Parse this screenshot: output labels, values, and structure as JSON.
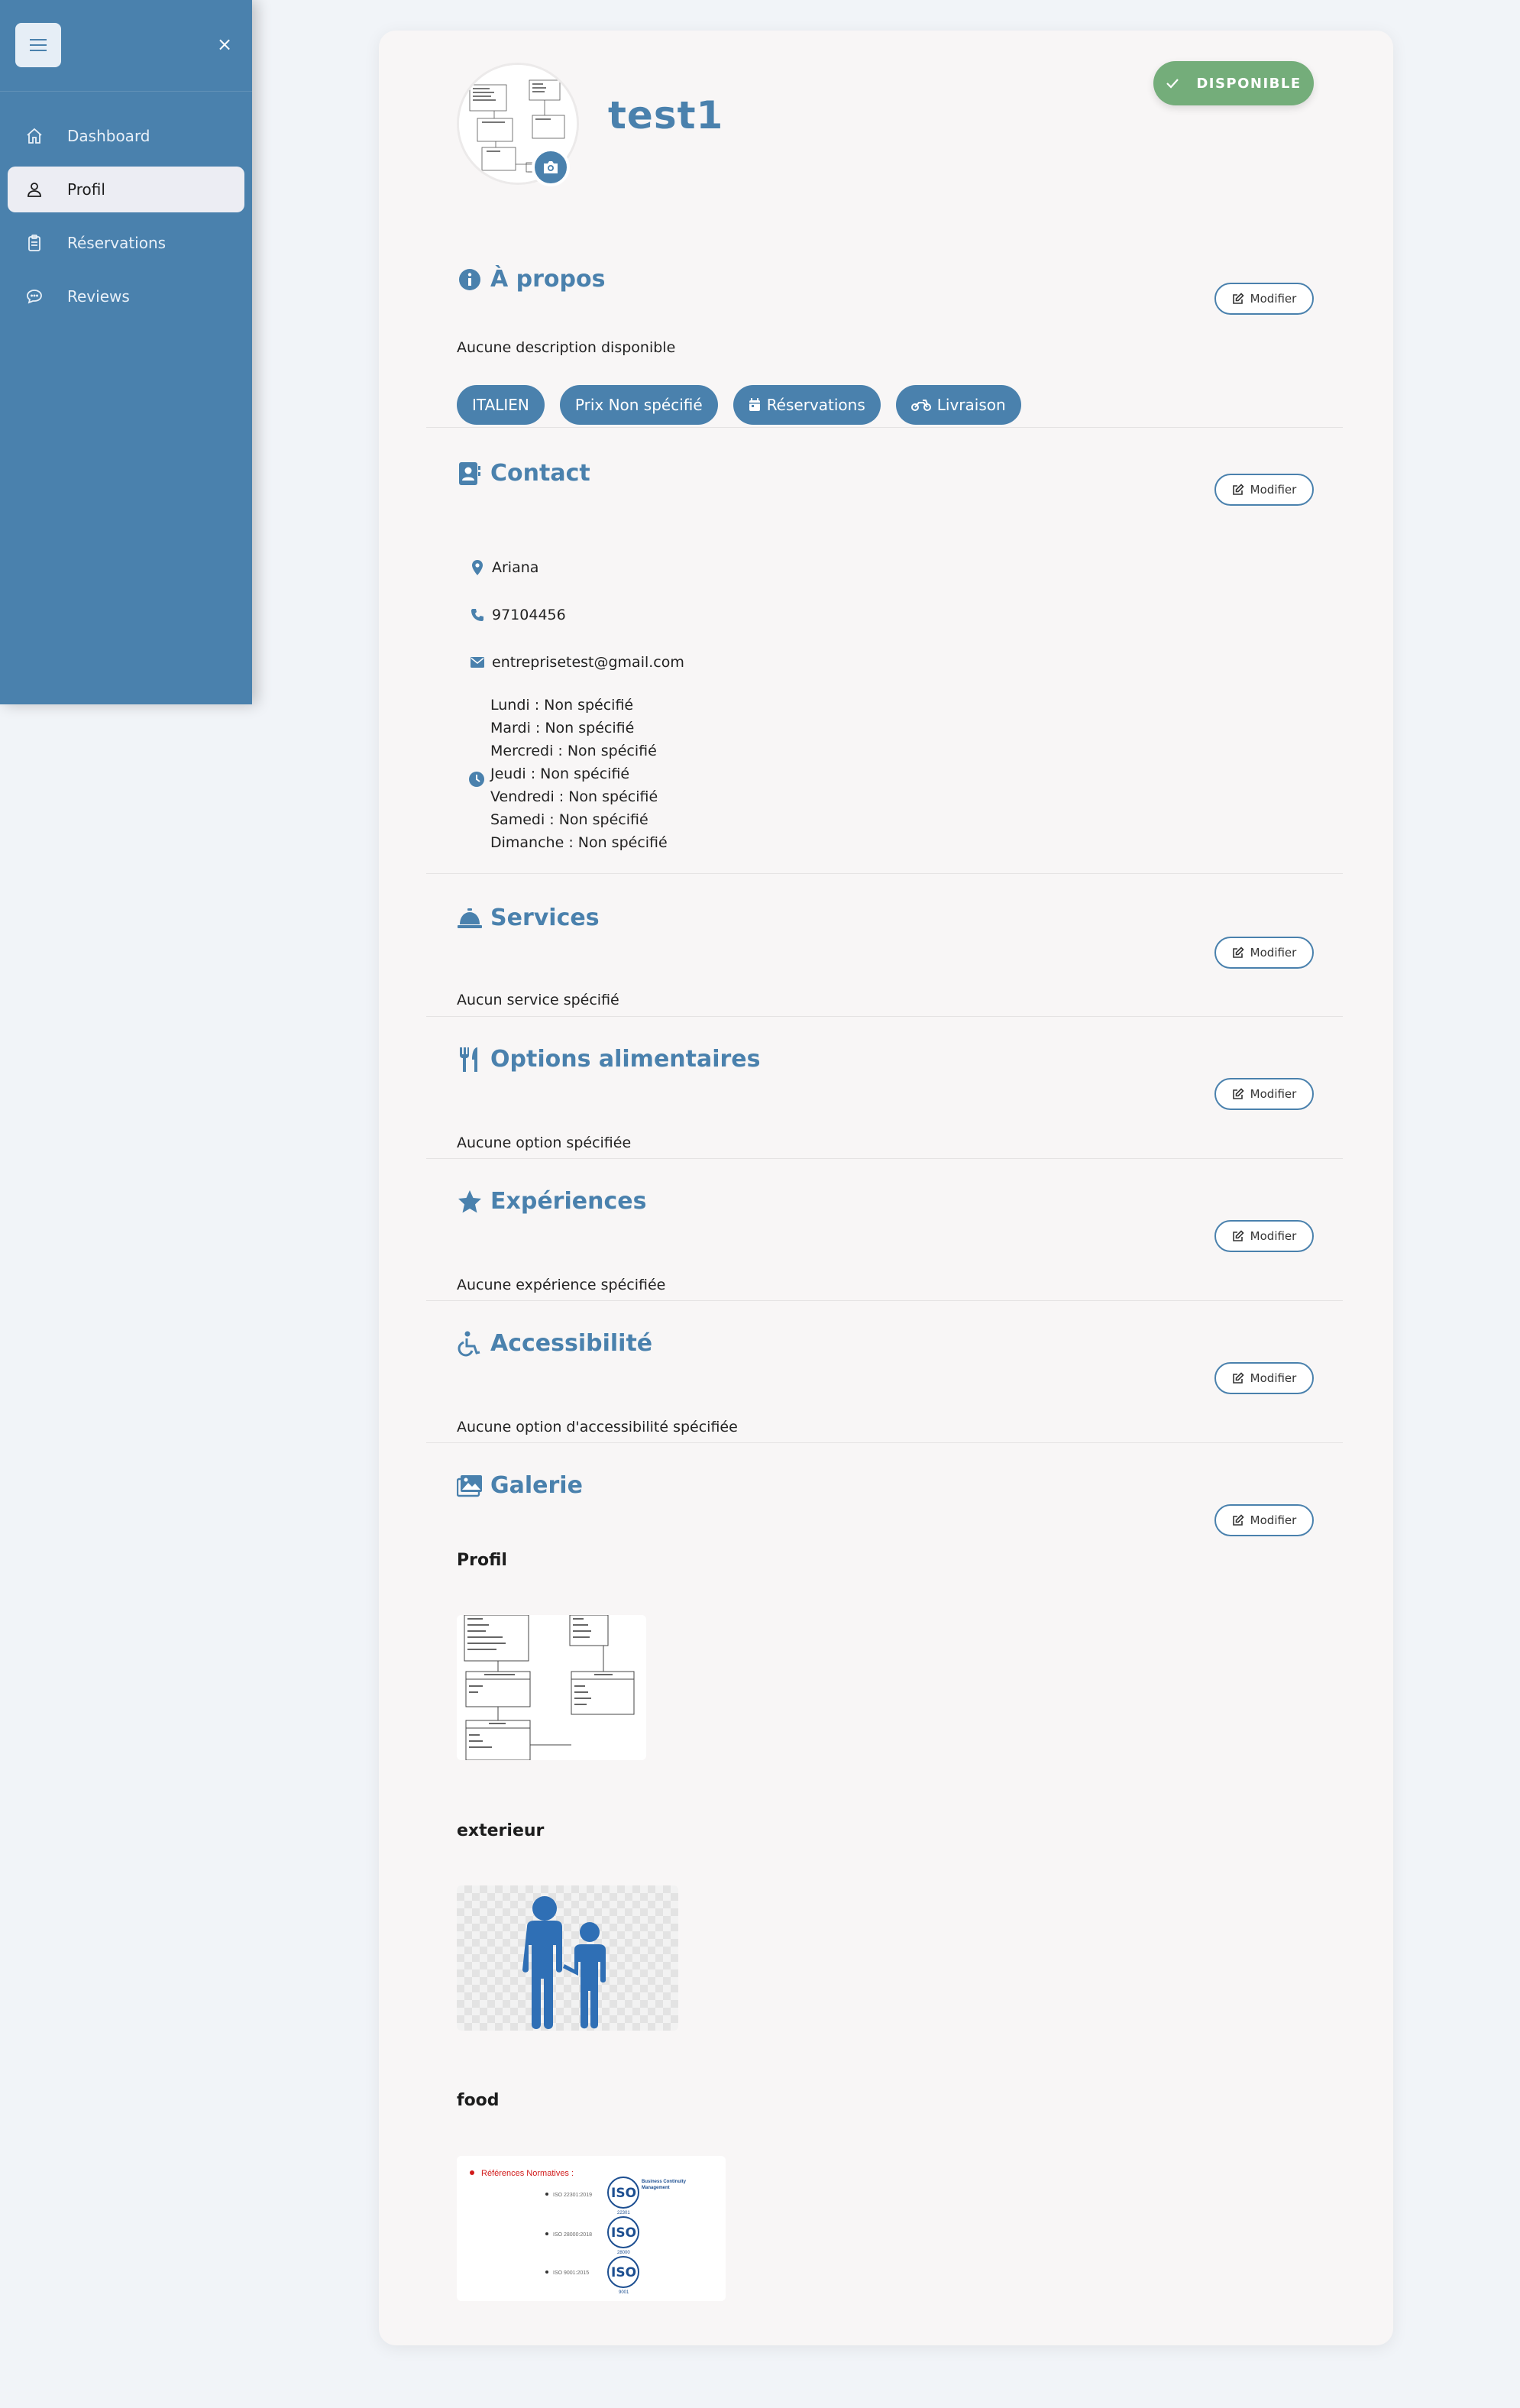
{
  "sidebar": {
    "items": [
      {
        "label": "Dashboard",
        "icon": "home-icon"
      },
      {
        "label": "Profil",
        "icon": "user-icon"
      },
      {
        "label": "Réservations",
        "icon": "clipboard-icon"
      },
      {
        "label": "Reviews",
        "icon": "chat-icon"
      }
    ],
    "close_label": "×",
    "active": "Profil"
  },
  "profile": {
    "name": "test1",
    "status": "DISPONIBLE",
    "status_color": "#74ad7a"
  },
  "about": {
    "title": "À propos",
    "modify_label": "Modifier",
    "description": "Aucune description disponible",
    "tags": [
      "ITALIEN",
      "Prix Non spécifié",
      "Réservations",
      "Livraison"
    ]
  },
  "contact": {
    "title": "Contact",
    "modify_label": "Modifier",
    "location": "Ariana",
    "phone": "97104456",
    "email": "entreprisetest@gmail.com",
    "hours": [
      "Lundi : Non spécifié",
      "Mardi : Non spécifié",
      "Mercredi : Non spécifié",
      "Jeudi : Non spécifié",
      "Vendredi : Non spécifié",
      "Samedi : Non spécifié",
      "Dimanche : Non spécifié"
    ]
  },
  "services": {
    "title": "Services",
    "modify_label": "Modifier",
    "text": "Aucun service spécifié"
  },
  "dietary": {
    "title": "Options alimentaires",
    "modify_label": "Modifier",
    "text": "Aucune option spécifiée"
  },
  "experiences": {
    "title": "Expériences",
    "modify_label": "Modifier",
    "text": "Aucune expérience spécifiée"
  },
  "accessibility": {
    "title": "Accessibilité",
    "modify_label": "Modifier",
    "text": "Aucune option d'accessibilité spécifiée"
  },
  "gallery": {
    "title": "Galerie",
    "modify_label": "Modifier",
    "groups": [
      {
        "label": "Profil"
      },
      {
        "label": "exterieur"
      },
      {
        "label": "food"
      }
    ],
    "food_image": {
      "heading": "Références Normatives :",
      "items": [
        "ISO 22301:2019",
        "ISO 28000:2018",
        "ISO 9001:2015"
      ],
      "badge": "ISO",
      "badge_numbers": [
        "22301",
        "28000",
        "9001"
      ],
      "caption": "Business Continuity Management"
    }
  },
  "colors": {
    "accent": "#4a81ad",
    "background": "#f1f4f8",
    "card": "#f8f6f6"
  }
}
